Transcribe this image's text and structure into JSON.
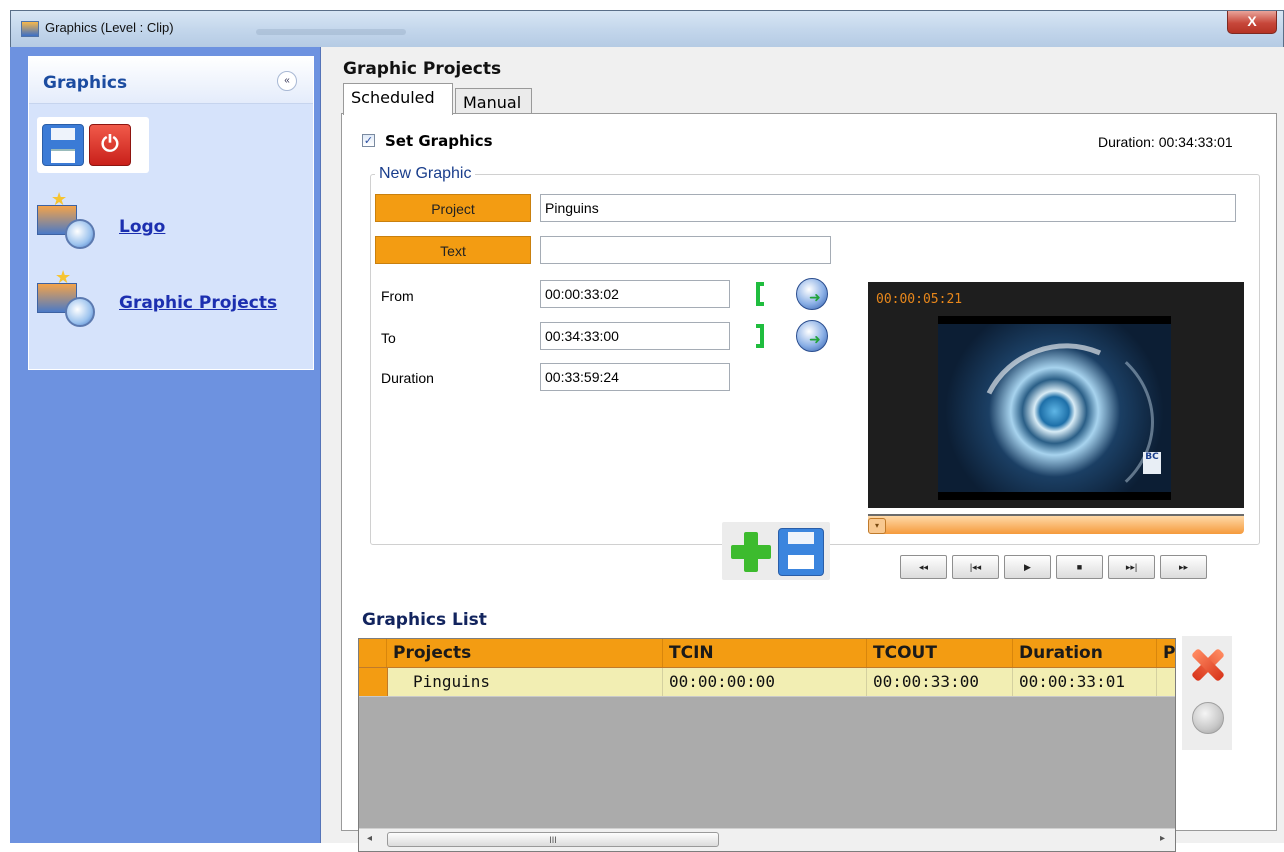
{
  "window": {
    "title": "Graphics (Level : Clip)",
    "close_glyph": "X"
  },
  "sidebar": {
    "header": "Graphics",
    "collapse_glyph": "«",
    "tools": {
      "save_icon": "floppy-disk-icon",
      "power_icon": "power-icon",
      "power_glyph": "⏻"
    },
    "items": [
      {
        "label": "Logo",
        "icon": "logo-icon"
      },
      {
        "label": "Graphic Projects",
        "icon": "graphic-projects-icon"
      }
    ]
  },
  "main": {
    "title": "Graphic Projects",
    "tabs": [
      {
        "label": "Scheduled",
        "active": true
      },
      {
        "label": "Manual",
        "active": false
      }
    ],
    "set_graphics": {
      "label": "Set Graphics",
      "checked": true,
      "check_glyph": "✓"
    },
    "duration_total": "Duration: 00:34:33:01",
    "new_graphic": {
      "legend": "New Graphic",
      "project_button": "Project",
      "project_value": "Pinguins",
      "text_button": "Text",
      "text_value": "",
      "from_label": "From",
      "from_value": "00:00:33:02",
      "to_label": "To",
      "to_value": "00:34:33:00",
      "duration_label": "Duration",
      "duration_value": "00:33:59:24"
    },
    "player": {
      "timecode": "00:00:05:21",
      "logo_text": "BC",
      "thumb_glyph": "▾",
      "buttons": [
        "◂◂",
        "|◂◂",
        "▶",
        "■",
        "▸▸|",
        "▸▸"
      ]
    },
    "graphics_list": {
      "title": "Graphics List",
      "columns": [
        "Projects",
        "TCIN",
        "TCOUT",
        "Duration",
        "P"
      ],
      "rows": [
        [
          "Pinguins",
          "00:00:00:00",
          "00:00:33:00",
          "00:00:33:01",
          ""
        ]
      ],
      "scroll_left": "◂",
      "scroll_right": "▸",
      "scroll_grip": "III"
    }
  },
  "colors": {
    "accent_orange": "#f39c12",
    "sidebar_blue": "#6d92e0",
    "bracket_green": "#1fbd3e"
  }
}
